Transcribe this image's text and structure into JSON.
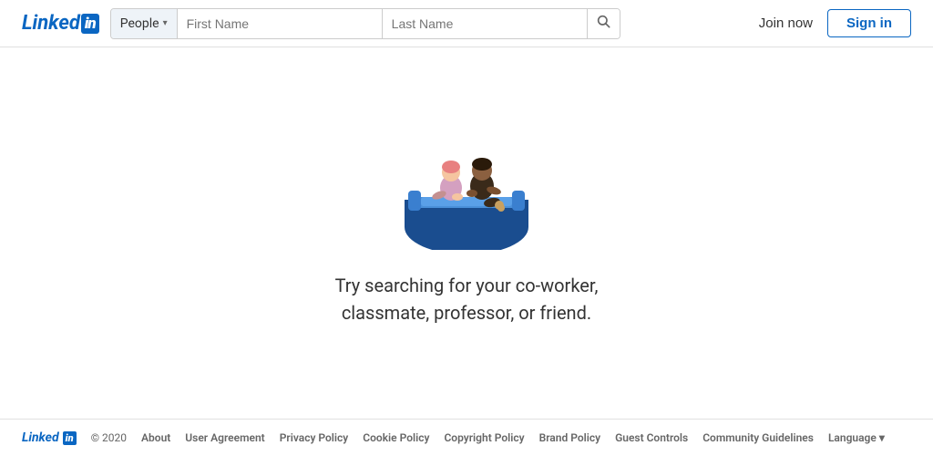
{
  "header": {
    "logo_text": "Linked",
    "logo_in": "in",
    "search": {
      "category_label": "People",
      "first_name_placeholder": "First Name",
      "last_name_placeholder": "Last Name"
    },
    "join_now_label": "Join now",
    "sign_in_label": "Sign in"
  },
  "main": {
    "empty_state_line1": "Try searching for your co-worker,",
    "empty_state_line2": "classmate, professor, or friend."
  },
  "footer": {
    "logo_text": "Linked",
    "logo_in": "in",
    "copyright": "© 2020",
    "links": [
      {
        "label": "About"
      },
      {
        "label": "User Agreement"
      },
      {
        "label": "Privacy Policy"
      },
      {
        "label": "Cookie Policy"
      },
      {
        "label": "Copyright Policy"
      },
      {
        "label": "Brand Policy"
      },
      {
        "label": "Guest Controls"
      },
      {
        "label": "Community Guidelines"
      }
    ],
    "language_label": "Language"
  },
  "icons": {
    "chevron": "▾",
    "search": "🔍"
  }
}
